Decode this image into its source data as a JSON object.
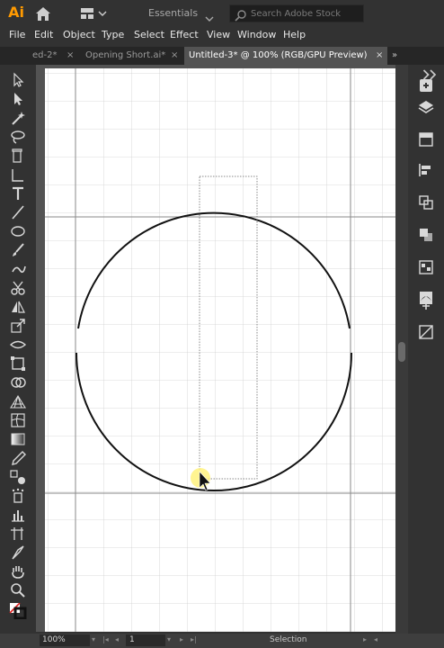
{
  "app": {
    "logo": "Ai"
  },
  "workspace": {
    "label": "Essentials"
  },
  "stock_search": {
    "placeholder": "Search Adobe Stock"
  },
  "menu": [
    "File",
    "Edit",
    "Object",
    "Type",
    "Select",
    "Effect",
    "View",
    "Window",
    "Help"
  ],
  "tabs": [
    {
      "label": "ed-2*",
      "active": false
    },
    {
      "label": "Opening Short.ai*",
      "active": false
    },
    {
      "label": "Untitled-3* @ 100% (RGB/GPU Preview)",
      "active": true
    }
  ],
  "tab_close_glyph": "×",
  "tabs_overflow_glyph": "»",
  "tools": [
    "selection-tool-icon",
    "direct-selection-tool-icon",
    "magic-wand-tool-icon",
    "lasso-tool-icon",
    "pen-tool-icon",
    "curvature-tool-icon",
    "type-tool-icon",
    "line-segment-tool-icon",
    "ellipse-tool-icon",
    "paintbrush-tool-icon",
    "shaper-tool-icon",
    "scissors-tool-icon",
    "reflect-tool-icon",
    "scale-tool-icon",
    "width-tool-icon",
    "free-transform-tool-icon",
    "shape-builder-tool-icon",
    "perspective-grid-tool-icon",
    "mesh-tool-icon",
    "gradient-tool-icon",
    "eyedropper-tool-icon",
    "blend-tool-icon",
    "symbol-sprayer-tool-icon",
    "column-graph-tool-icon",
    "artboard-tool-icon",
    "slice-tool-icon",
    "hand-tool-icon",
    "zoom-tool-icon"
  ],
  "right_panel": [
    "libraries-icon",
    "layers-icon",
    "properties-icon",
    "align-icon",
    "pathfinder-icon",
    "transform-icon",
    "color-guide-icon",
    "brushes-icon",
    "symbols-icon",
    "graphic-styles-icon"
  ],
  "status": {
    "zoom": "100%",
    "page": "1",
    "mode": "Selection"
  },
  "colors": {
    "accent_logo": "#ff9a00",
    "ui_dark": "#323232",
    "artboard": "#ffffff",
    "cursor_highlight": "#fff176"
  }
}
